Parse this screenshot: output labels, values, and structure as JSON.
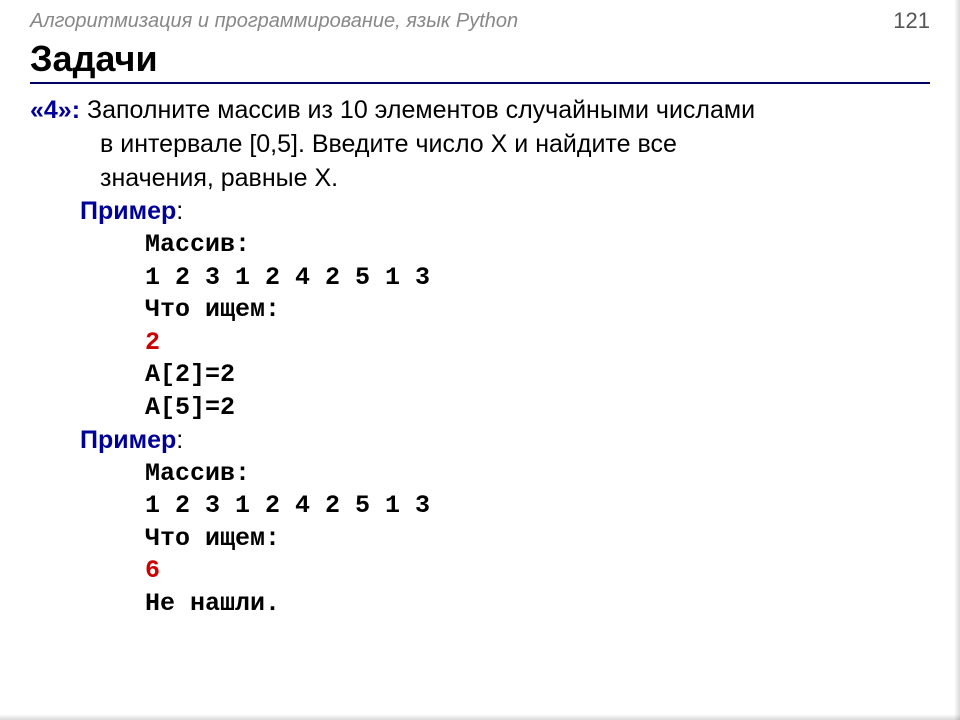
{
  "header": {
    "subject": "Алгоритмизация и программирование, язык Python",
    "page_number": "121"
  },
  "title": "Задачи",
  "task": {
    "number": "«4»:",
    "line1": "Заполните массив из 10 элементов случайными числами",
    "line2": "в интервале [0,5]. Введите число X и найдите все",
    "line3": "значения, равные X."
  },
  "example1": {
    "label": "Пример",
    "colon": ":",
    "lines": {
      "l1": "Массив:",
      "l2": "1 2 3 1 2 4 2 5 1 3",
      "l3": "Что ищем:",
      "l4": "2",
      "l5": "A[2]=2",
      "l6": "A[5]=2"
    }
  },
  "example2": {
    "label": "Пример",
    "colon": ":",
    "lines": {
      "l1": "Массив:",
      "l2": "1 2 3 1 2 4 2 5 1 3",
      "l3": "Что ищем:",
      "l4": "6",
      "l5": "Не нашли."
    }
  }
}
